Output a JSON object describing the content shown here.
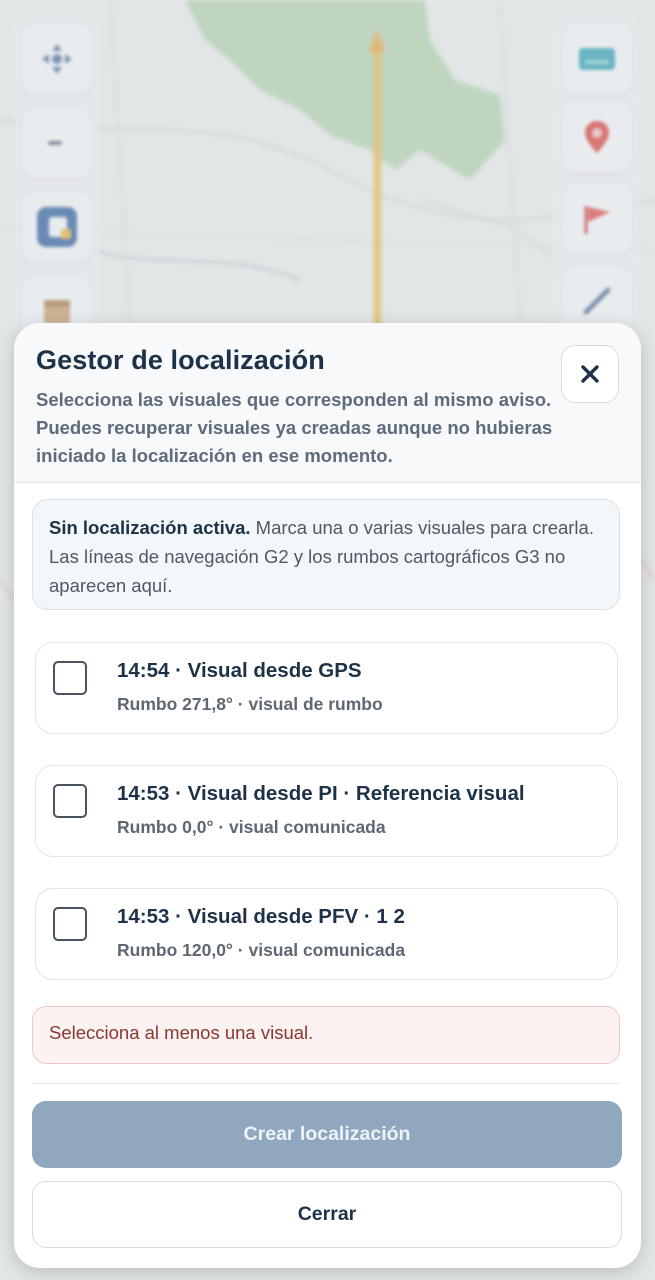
{
  "map": {
    "left_tools": [
      "move-icon",
      "minus-icon",
      "layers-app-icon",
      "calendar-icon"
    ],
    "right_tools": [
      "keyboard-icon",
      "location-pin-icon",
      "flag-icon",
      "ruler-icon"
    ],
    "colors": {
      "forest": "#a7cca4",
      "trail": "#e8b64a",
      "road": "#c9cfd6"
    }
  },
  "sheet": {
    "title": "Gestor de localización",
    "description": "Selecciona las visuales que corresponden al mismo aviso. Puedes recuperar visuales ya creadas aunque no hubieras iniciado la localización en ese momento.",
    "close_icon": "close-icon",
    "info": {
      "strong": "Sin localización activa.",
      "text": " Marca una o varias visuales para crearla. Las líneas de navegación G2 y los rumbos cartográficos G3 no aparecen aquí."
    },
    "visuals": [
      {
        "title": "14:54 · Visual desde GPS",
        "subtitle": "Rumbo 271,8° · visual de rumbo",
        "checked": false
      },
      {
        "title": "14:53 · Visual desde PI · Referencia visual",
        "subtitle": "Rumbo 0,0° · visual comunicada",
        "checked": false
      },
      {
        "title": "14:53 · Visual desde PFV · 1 2",
        "subtitle": "Rumbo 120,0° · visual comunicada",
        "checked": false
      }
    ],
    "error": "Selecciona al menos una visual.",
    "primary_button": "Crear localización",
    "secondary_button": "Cerrar",
    "colors": {
      "primary_disabled": "#8fa8bf",
      "heading": "#1d3147",
      "error_text": "#8b3631"
    }
  }
}
